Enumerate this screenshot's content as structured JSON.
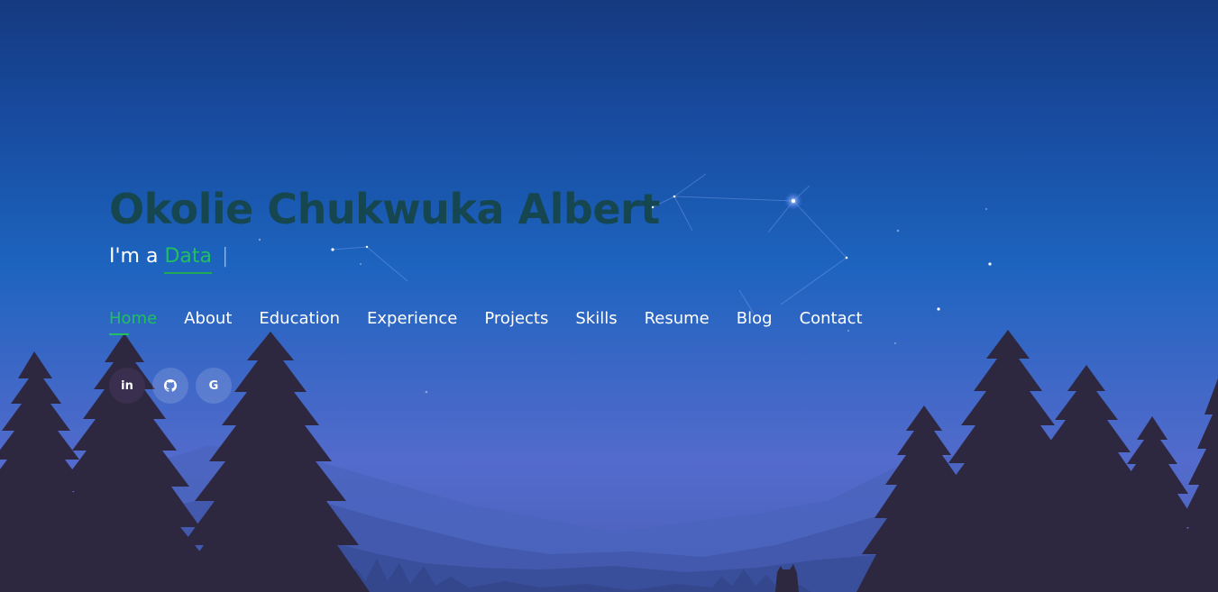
{
  "hero": {
    "name": "Okolie Chukwuka Albert",
    "typed_prefix": "I'm a",
    "typed_word": "Data",
    "cursor": "|"
  },
  "nav": {
    "items": [
      {
        "label": "Home",
        "active": true
      },
      {
        "label": "About",
        "active": false
      },
      {
        "label": "Education",
        "active": false
      },
      {
        "label": "Experience",
        "active": false
      },
      {
        "label": "Projects",
        "active": false
      },
      {
        "label": "Skills",
        "active": false
      },
      {
        "label": "Resume",
        "active": false
      },
      {
        "label": "Blog",
        "active": false
      },
      {
        "label": "Contact",
        "active": false
      }
    ]
  },
  "social": [
    {
      "icon": "linkedin-icon",
      "glyph": "in"
    },
    {
      "icon": "github-icon",
      "glyph": "github"
    },
    {
      "icon": "google-icon",
      "glyph": "G"
    }
  ],
  "colors": {
    "accent": "#20c060",
    "name": "#16464f",
    "tree": "#2d2740",
    "sky_top": "#153a80",
    "sky_bottom": "#536bcc"
  }
}
